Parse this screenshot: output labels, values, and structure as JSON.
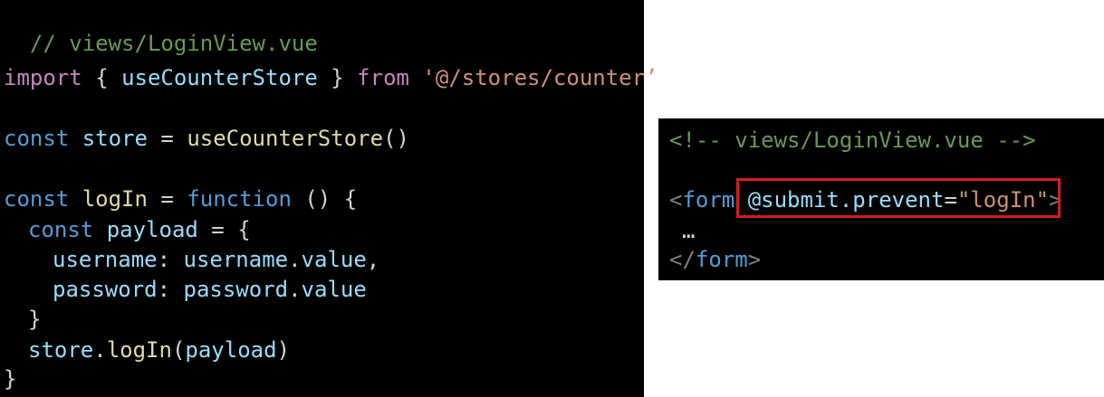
{
  "left_code": {
    "line1": {
      "comment": "// views/LoginView.vue"
    },
    "line2": {
      "kw_import": "import",
      "brace_open": "{ ",
      "ident": "useCounterStore",
      "brace_close": " }",
      "kw_from": "from",
      "path": "'@/stores/counter’"
    },
    "line3": {
      "kw_const": "const",
      "var": "store",
      "eq": " = ",
      "fn": "useCounterStore",
      "call": "()"
    },
    "line4": {
      "kw_const": "const",
      "var": "logIn",
      "eq": " = ",
      "kw_function": "function",
      "rest": " () {"
    },
    "line5": {
      "kw_const": "const",
      "var": "payload",
      "rest": " = {"
    },
    "line6": {
      "key": "username",
      "colon": ": ",
      "obj": "username",
      "dot": ".",
      "prop": "value",
      "comma": ","
    },
    "line7": {
      "key": "password",
      "colon": ": ",
      "obj": "password",
      "dot": ".",
      "prop": "value"
    },
    "line8": {
      "text": "}"
    },
    "line9": {
      "obj": "store",
      "dot": ".",
      "fn": "logIn",
      "open": "(",
      "arg": "payload",
      "close": ")"
    },
    "line10": {
      "text": "}"
    }
  },
  "right_code": {
    "line1": {
      "comment": "<!-- views/LoginView.vue -->"
    },
    "line2": {
      "lt": "<",
      "tag": "form",
      "attr": "@submit.prevent",
      "eq": "=",
      "val": "\"logIn\"",
      "gt": ">"
    },
    "line3": {
      "text": "…"
    },
    "line4": {
      "lt": "</",
      "tag": "form",
      "gt": ">"
    }
  },
  "colors": {
    "highlight_border": "#d11f1f",
    "background": "#000000"
  }
}
